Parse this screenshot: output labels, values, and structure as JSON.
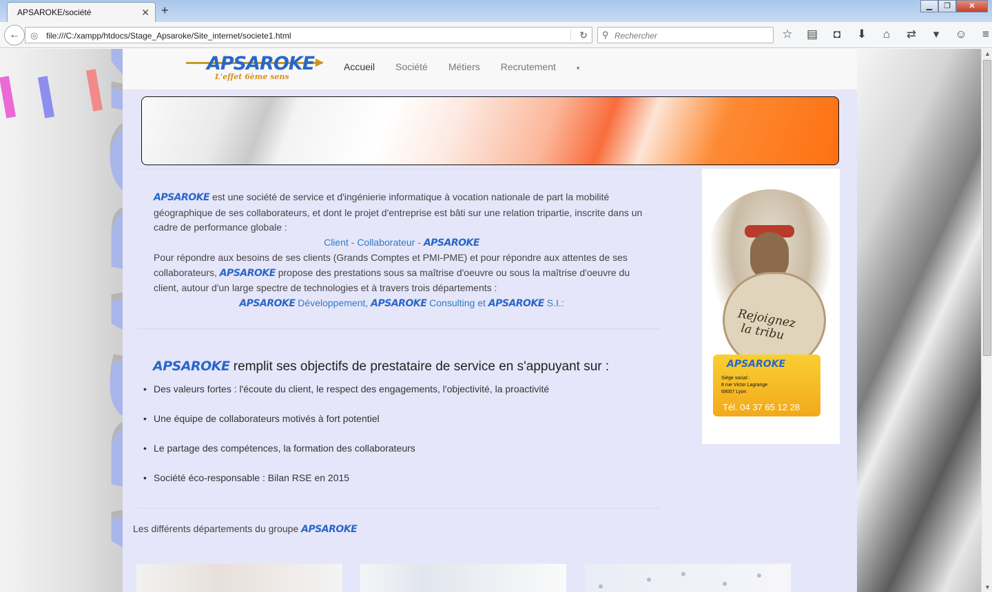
{
  "browser": {
    "tab_title": "APSAROKE/société",
    "url": "file:///C:/xampp/htdocs/Stage_Apsaroke/Site_internet/societe1.html",
    "search_placeholder": "Rechercher"
  },
  "site": {
    "logo_text": "APSAROKE",
    "logo_tagline": "L'effet 6ème sens",
    "nav": [
      "Accueil",
      "Société",
      "Métiers",
      "Recrutement"
    ]
  },
  "intro": {
    "brand": "APSAROKE",
    "p1": " est une société de service et d'ingénierie informatique à vocation nationale de part la mobilité géographique de ses collaborateurs, et dont le projet d'entreprise est bâti sur une relation tripartie, inscrite dans un cadre de performance globale :",
    "triangle": "Client - Collaborateur - ",
    "p2a": "Pour répondre aux besoins de ses clients (Grands Comptes et PMI-PME) et pour répondre aux attentes de ses collaborateurs, ",
    "p2b": " propose des prestations sous sa maîtrise d'oeuvre ou sous la maîtrise d'oeuvre du client, autour d'un large spectre de technologies et à travers trois départements :",
    "dept1": " Développement, ",
    "dept2": " Consulting et ",
    "dept3": " S.I.:"
  },
  "objectifs": {
    "heading": " remplit ses objectifs de prestataire de service en s'appuyant sur :",
    "items": [
      "Des valeurs fortes : l'écoute du client, le respect des engagements, l'objectivité, la proactivité",
      "Une équipe de collaborateurs motivés à fort potentiel",
      "Le partage des compétences, la formation des collaborateurs",
      "Société éco-responsable : Bilan RSE en 2015"
    ]
  },
  "departements": {
    "label": "Les différents départements du groupe "
  },
  "ad": {
    "slogan_line1": "Rejoignez",
    "slogan_line2": "la tribu",
    "card_brand": "APSAROKE",
    "address_line1": "Siège social :",
    "address_line2": "8 rue Victor Lagrange",
    "address_line3": "69007 Lyon",
    "phone": "Tél. 04 37 65 12 28"
  },
  "side_text": "APSAROKE"
}
